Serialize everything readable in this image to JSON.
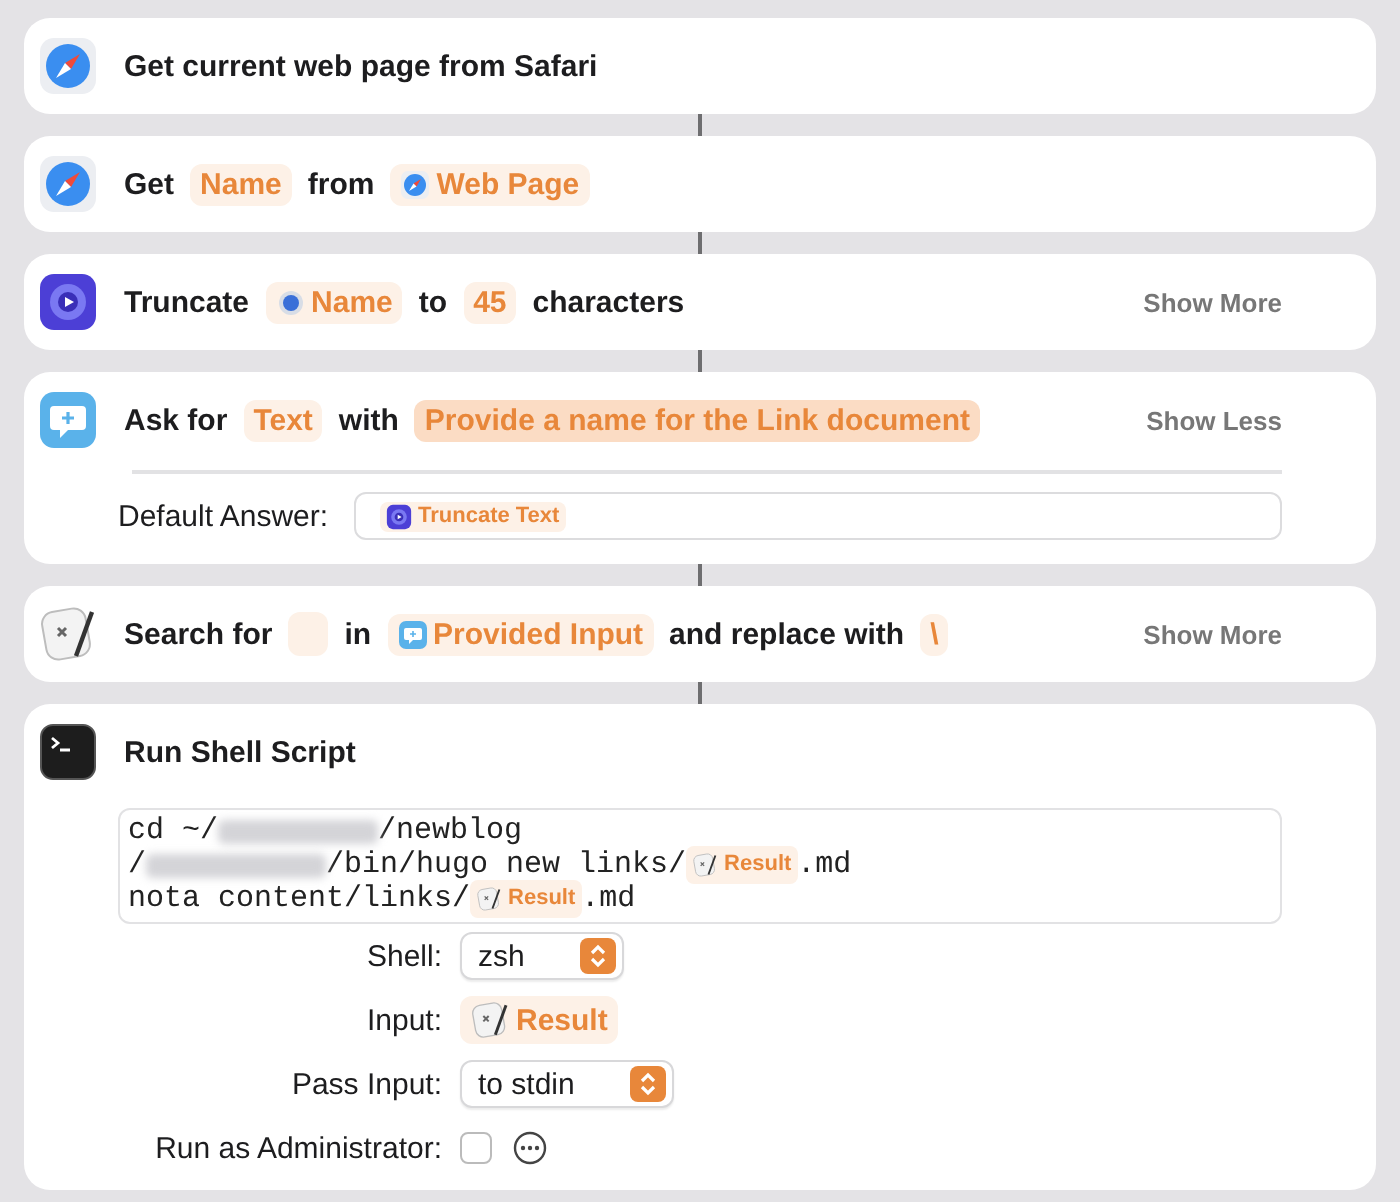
{
  "actions": [
    {
      "kind": "simple",
      "parts": [
        {
          "kind": "text",
          "text": "Get current web page from Safari"
        }
      ]
    },
    {
      "kind": "simple",
      "parts": [
        {
          "kind": "text",
          "text": "Get"
        },
        {
          "kind": "token",
          "text": "Name",
          "selected": false
        },
        {
          "kind": "text",
          "text": "from"
        },
        {
          "kind": "token",
          "text": "Web Page",
          "selected": false
        }
      ]
    },
    {
      "kind": "simple",
      "toggle": "Show More",
      "parts": [
        {
          "kind": "text",
          "text": "Truncate"
        },
        {
          "kind": "token",
          "text": "Name",
          "selected": false
        },
        {
          "kind": "text",
          "text": "to"
        },
        {
          "kind": "token",
          "text": "45",
          "selected": false
        },
        {
          "kind": "text",
          "text": "characters"
        }
      ]
    },
    {
      "kind": "ask",
      "toggle": "Show Less",
      "parts": [
        {
          "kind": "text",
          "text": "Ask for"
        },
        {
          "kind": "token",
          "text": "Text",
          "selected": false
        },
        {
          "kind": "text",
          "text": "with"
        },
        {
          "kind": "token",
          "text": "Provide a name for the Link document",
          "selected": true
        }
      ],
      "default_answer": {
        "label": "Default Answer:",
        "text": "Truncate Text"
      }
    },
    {
      "kind": "simple",
      "toggle": "Show More",
      "parts": [
        {
          "kind": "text",
          "text": "Search for"
        },
        {
          "kind": "empty"
        },
        {
          "kind": "text",
          "text": "in"
        },
        {
          "kind": "token",
          "text": "Provided Input",
          "selected": false
        },
        {
          "kind": "text",
          "text": "and replace with"
        },
        {
          "kind": "token",
          "text": "\\",
          "selected": false
        }
      ]
    },
    {
      "kind": "shell",
      "parts": [
        {
          "kind": "text",
          "text": "Run Shell Script"
        }
      ],
      "script": [
        [
          {
            "kind": "code",
            "text": "cd ~/"
          },
          {
            "kind": "blur"
          },
          {
            "kind": "code",
            "text": "/newblog"
          }
        ],
        [
          {
            "kind": "code",
            "text": "/"
          },
          {
            "kind": "blur"
          },
          {
            "kind": "code",
            "text": "/bin/hugo new links/"
          },
          {
            "kind": "token",
            "text": "Result"
          },
          {
            "kind": "code",
            "text": ".md"
          }
        ],
        [
          {
            "kind": "code",
            "text": "nota content/links/"
          },
          {
            "kind": "token",
            "text": "Result"
          },
          {
            "kind": "code",
            "text": ".md"
          }
        ]
      ],
      "options": [
        {
          "kind": "select",
          "label": "Shell:",
          "value": "zsh"
        },
        {
          "kind": "variable",
          "label": "Input:",
          "value": "Result"
        },
        {
          "kind": "select",
          "label": "Pass Input:",
          "value": "to stdin"
        },
        {
          "kind": "checkbox",
          "label": "Run as Administrator:",
          "checked": false
        }
      ]
    }
  ]
}
